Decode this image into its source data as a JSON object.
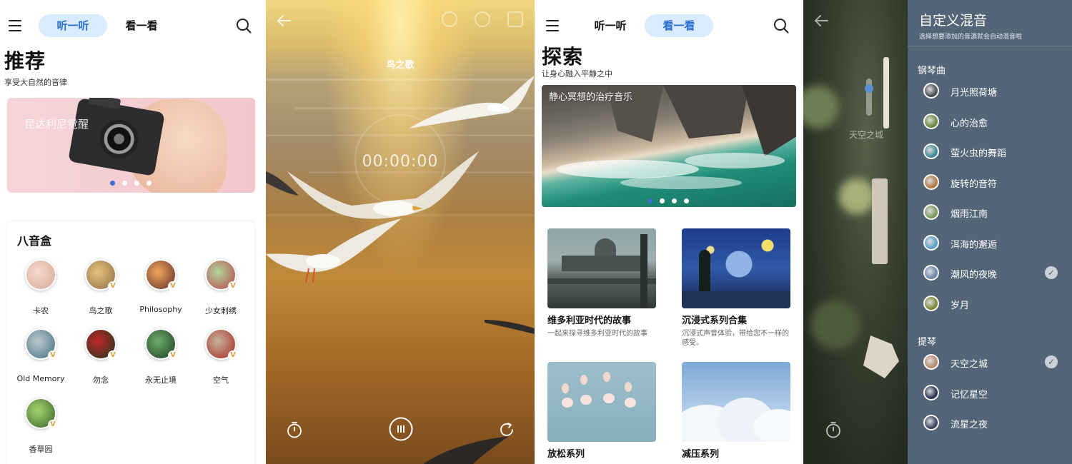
{
  "listen_screen": {
    "tabs": [
      "听一听",
      "看一看"
    ],
    "active_tab": 0,
    "heading": "推荐",
    "subheading": "享受大自然的音律",
    "banner": {
      "title": "昆达利尼觉醒",
      "dots": 4,
      "active_dot": 0
    },
    "music_box": {
      "title": "八音盒",
      "vip_badge": "V",
      "items": [
        {
          "label": "卡农",
          "colors": [
            "#f3d9cf",
            "#d9a995"
          ],
          "vip": false
        },
        {
          "label": "鸟之歌",
          "colors": [
            "#e8c27a",
            "#8a6c4a"
          ],
          "vip": true
        },
        {
          "label": "Philosophy",
          "colors": [
            "#f2a65a",
            "#5a2e2a"
          ],
          "vip": true
        },
        {
          "label": "少女刺绣",
          "colors": [
            "#b2d59a",
            "#b5434a"
          ],
          "vip": true
        },
        {
          "label": "Old Memory",
          "colors": [
            "#bfc8cf",
            "#3e6f7e"
          ],
          "vip": true
        },
        {
          "label": "勿念",
          "colors": [
            "#c2262a",
            "#1b3a1b"
          ],
          "vip": true
        },
        {
          "label": "永无止境",
          "colors": [
            "#6fae6a",
            "#1d3b24"
          ],
          "vip": true
        },
        {
          "label": "空气",
          "colors": [
            "#c7b29a",
            "#a4281f"
          ],
          "vip": true
        },
        {
          "label": "香草园",
          "colors": [
            "#a6d46b",
            "#37622b"
          ],
          "vip": true
        }
      ]
    }
  },
  "player_screen": {
    "title": "鸟之歌",
    "timer": "00:00:00"
  },
  "watch_screen": {
    "tabs": [
      "听一听",
      "看一看"
    ],
    "active_tab": 1,
    "heading": "探索",
    "subheading": "让身心融入平静之中",
    "banner": {
      "title": "静心冥想的治疗音乐",
      "dots": 4,
      "active_dot": 0
    },
    "tiles": [
      {
        "title": "维多利亚时代的故事",
        "desc": "一起来探寻维多利亚时代的故事",
        "theme": "victorian"
      },
      {
        "title": "沉浸式系列合集",
        "desc": "沉浸式声音体验，带给您不一样的感受。",
        "theme": "starry"
      },
      {
        "title": "放松系列",
        "desc": "",
        "theme": "flamingo"
      },
      {
        "title": "减压系列",
        "desc": "",
        "theme": "clouds"
      }
    ]
  },
  "mix_screen": {
    "background_title": "天空之城",
    "panel_title": "自定义混音",
    "panel_subtitle": "选择想要添加的音源就会自动混音啦",
    "sections": [
      {
        "label": "钢琴曲",
        "items": [
          {
            "label": "月光照荷塘",
            "color": "#4a4f57",
            "checked": false
          },
          {
            "label": "心的治愈",
            "color": "#6b8a3c",
            "checked": false
          },
          {
            "label": "萤火虫的舞蹈",
            "color": "#3f8a93",
            "checked": false
          },
          {
            "label": "旋转的音符",
            "color": "#b07a42",
            "checked": false
          },
          {
            "label": "烟雨江南",
            "color": "#7d9a5a",
            "checked": false
          },
          {
            "label": "洱海的邂逅",
            "color": "#5aa0c9",
            "checked": false
          },
          {
            "label": "潮风的夜晚",
            "color": "#6f86a8",
            "checked": true
          },
          {
            "label": "岁月",
            "color": "#7e8a3a",
            "checked": false
          }
        ]
      },
      {
        "label": "提琴",
        "items": [
          {
            "label": "天空之城",
            "color": "#b78b6c",
            "checked": true
          },
          {
            "label": "记忆星空",
            "color": "#2b3550",
            "checked": false
          },
          {
            "label": "流星之夜",
            "color": "#3a4660",
            "checked": false
          }
        ]
      }
    ],
    "check_mark": "✓"
  }
}
